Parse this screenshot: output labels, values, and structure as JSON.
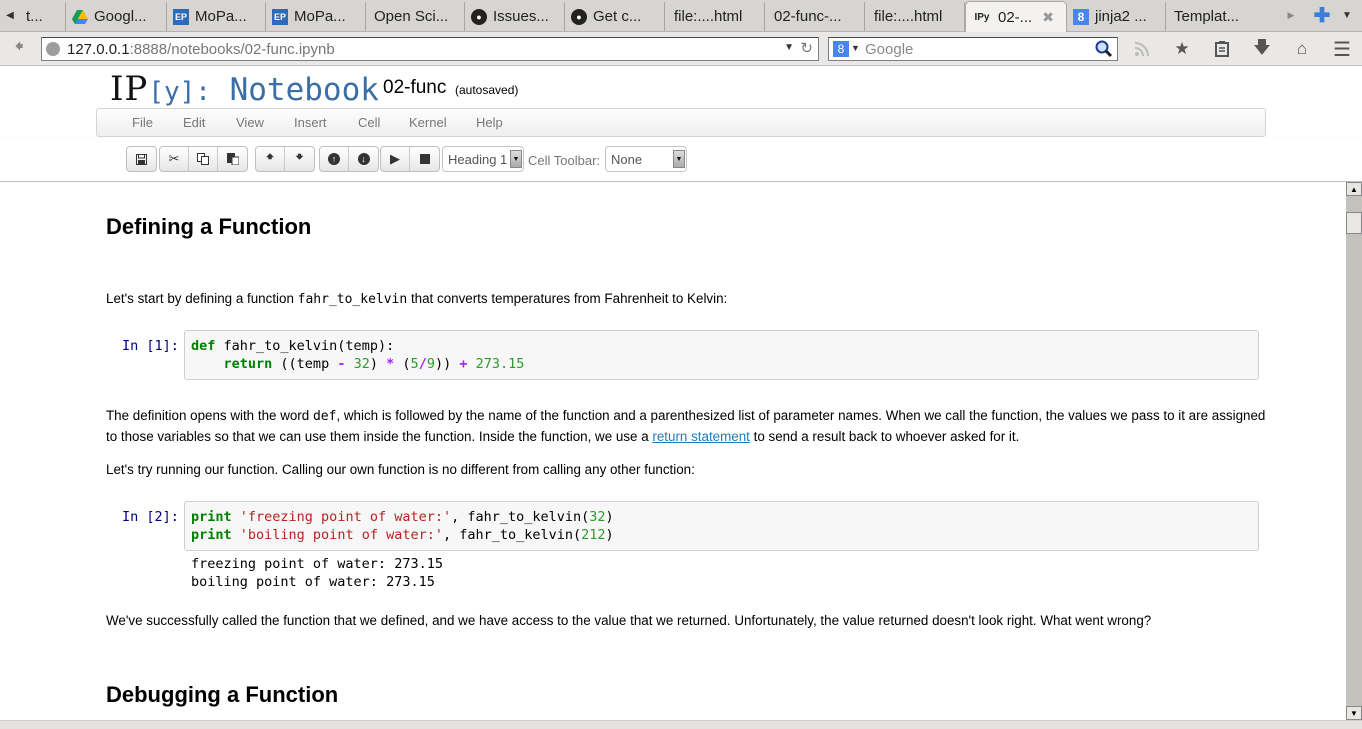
{
  "browser": {
    "tabs": [
      {
        "label": "t...",
        "icon": "page-icon"
      },
      {
        "label": "Googl...",
        "icon": "google-drive-icon"
      },
      {
        "label": "MoPa...",
        "icon": "ep-icon"
      },
      {
        "label": "MoPa...",
        "icon": "ep-icon"
      },
      {
        "label": "Open Sci...",
        "icon": "none"
      },
      {
        "label": "Issues...",
        "icon": "github-icon"
      },
      {
        "label": "Get c...",
        "icon": "github-icon"
      },
      {
        "label": "file:....html",
        "icon": "none"
      },
      {
        "label": "02-func-...",
        "icon": "none"
      },
      {
        "label": "file:....html",
        "icon": "none"
      },
      {
        "label": "02-...",
        "icon": "ipython-icon",
        "active": true
      },
      {
        "label": "jinja2 ...",
        "icon": "google-icon"
      },
      {
        "label": "Templat...",
        "icon": "none"
      }
    ],
    "tab_icon_text": {
      "ep": "EP",
      "ipy": "IPy",
      "g": "8"
    },
    "url_host": "127.0.0.1",
    "url_rest": ":8888/notebooks/02-func.ipynb",
    "search_placeholder": "Google",
    "engine_letter": "8"
  },
  "notebook": {
    "logo_ip": "IP",
    "logo_y": "[y]:",
    "logo_nb": " Notebook",
    "name": "02-func",
    "save_status": "(autosaved)",
    "menu": [
      "File",
      "Edit",
      "View",
      "Insert",
      "Cell",
      "Kernel",
      "Help"
    ],
    "cell_type": "Heading 1",
    "cell_toolbar_label": "Cell Toolbar:",
    "cell_toolbar_value": "None"
  },
  "cells": {
    "h1_defining": "Defining a Function",
    "p1_before": "Let's start by defining a function ",
    "p1_code": "fahr_to_kelvin",
    "p1_after": " that converts temperatures from Fahrenheit to Kelvin:",
    "in1_prompt": "In [1]:",
    "in1_code": {
      "l1_kw": "def",
      "l1_rest": " fahr_to_kelvin(temp):",
      "l2_kw": "return",
      "l2_a": " ((temp ",
      "l2_minus": "-",
      "l2_32": "32",
      "l2_b": ") ",
      "l2_star": "*",
      "l2_c": " (",
      "l2_5": "5",
      "l2_slash": "/",
      "l2_9": "9",
      "l2_d": ")) ",
      "l2_plus": "+",
      "l2_num": "273.15"
    },
    "p2_a": "The definition opens with the word ",
    "p2_code": "def",
    "p2_b": ", which is followed by the name of the function and a parenthesized list of parameter names. When we call the function, the values we pass to it are assigned to those variables so that we can use them inside the function. Inside the function, we use a ",
    "p2_link": "return statement",
    "p2_c": " to send a result back to whoever asked for it.",
    "p3": "Let's try running our function. Calling our own function is no different from calling any other function:",
    "in2_prompt": "In [2]:",
    "in2_code": {
      "l1_kw": "print",
      "l1_str": "'freezing point of water:'",
      "l1_mid": ", fahr_to_kelvin(",
      "l1_num": "32",
      "l1_end": ")",
      "l2_kw": "print",
      "l2_str": "'boiling point of water:'",
      "l2_mid": ", fahr_to_kelvin(",
      "l2_num": "212",
      "l2_end": ")"
    },
    "out2_l1": "freezing point of water: 273.15",
    "out2_l2": "boiling point of water: 273.15",
    "p4": "We've successfully called the function that we defined, and we have access to the value that we returned. Unfortunately, the value returned doesn't look right. What went wrong?",
    "h1_debugging": "Debugging a Function"
  }
}
